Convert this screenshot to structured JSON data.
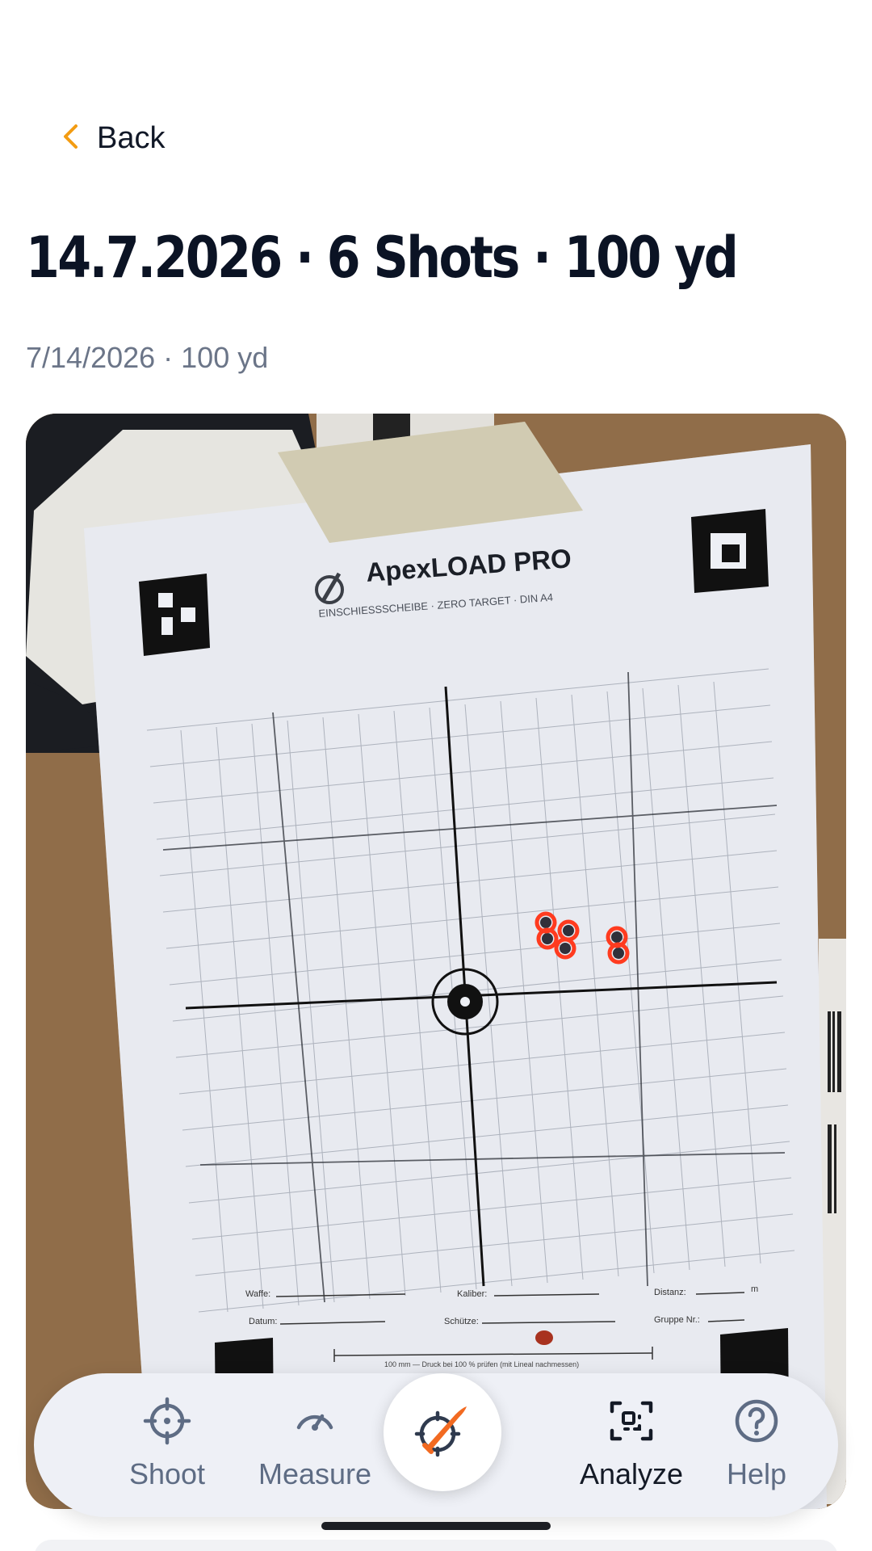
{
  "header": {
    "back_label": "Back",
    "title": "14.7.2026 · 6 Shots · 100 yd",
    "subtitle": "7/14/2026 · 100 yd"
  },
  "target_photo": {
    "brand": "ApexLOAD PRO",
    "subheading": "EINSCHIESSSCHEIBE · ZERO TARGET · DIN A4",
    "form_fields": [
      "Waffe:",
      "Kaliber:",
      "Distanz:",
      "m",
      "Datum:",
      "Schütze:",
      "Gruppe Nr.:"
    ],
    "ruler_text": "100 mm — Druck bei 100 % prüfen (mit Lineal nachmessen)",
    "shot_count": 6,
    "shot_marker_color": "#ff3b1f"
  },
  "nav": {
    "items": [
      {
        "label": "Shoot",
        "icon": "crosshair-icon"
      },
      {
        "label": "Measure",
        "icon": "gauge-icon"
      },
      {
        "label": "Analyze",
        "icon": "scan-icon"
      },
      {
        "label": "Help",
        "icon": "help-circle-icon"
      }
    ],
    "center_action_icon": "target-bullet-icon",
    "active": "Analyze",
    "accent": "#f26a21"
  },
  "colors": {
    "back_chevron": "#f39c12",
    "text_primary": "#0b1324",
    "text_secondary": "#6b7588",
    "nav_bg": "#eef0f6"
  }
}
